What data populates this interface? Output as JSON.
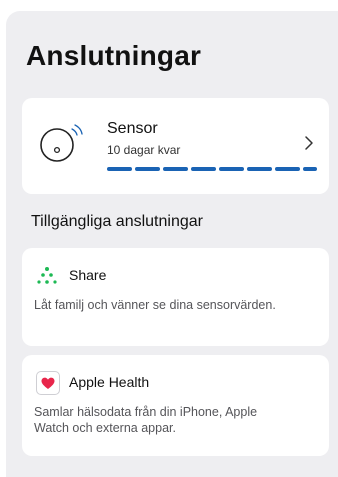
{
  "page": {
    "title": "Anslutningar"
  },
  "sensor": {
    "name": "Sensor",
    "remaining": "10 dagar kvar",
    "progress_segments": 8,
    "accent_color": "#1a63b4"
  },
  "available": {
    "title": "Tillgängliga anslutningar",
    "items": [
      {
        "name": "Share",
        "description": "Låt familj och vänner se dina sensorvärden.",
        "icon": "share-dots-icon",
        "icon_color": "#1db954"
      },
      {
        "name": "Apple Health",
        "description": "Samlar hälsodata från din iPhone, Apple Watch och externa appar.",
        "icon": "heart-icon",
        "icon_color": "#e8264b"
      }
    ]
  }
}
